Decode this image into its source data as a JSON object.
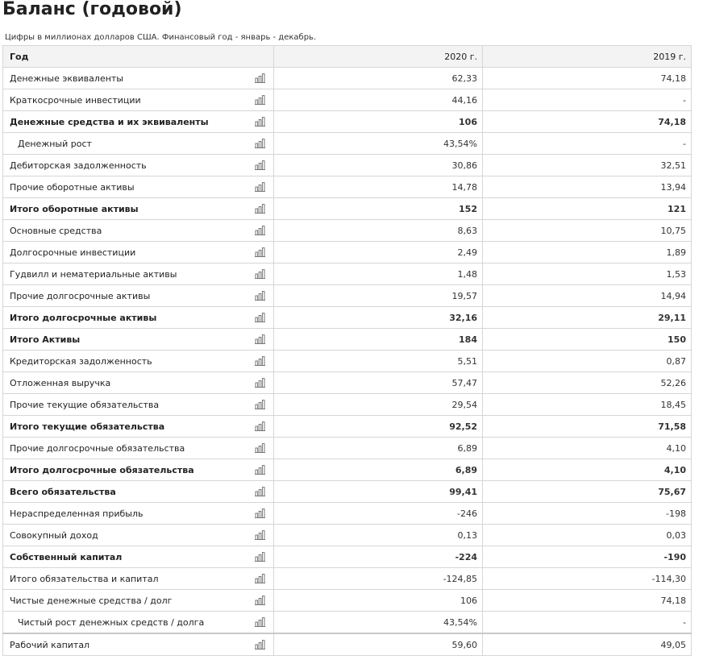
{
  "page": {
    "title": "Баланс (годовой)",
    "subtitle": "Цифры в миллионах долларов США. Финансовый год - январь - декабрь."
  },
  "table": {
    "header": {
      "label": "Год",
      "col1": "2020 г.",
      "col2": "2019 г."
    },
    "chart_icon": "bar-chart-icon",
    "rows": [
      {
        "label": "Денежные эквиваленты",
        "v1": "62,33",
        "v2": "74,18",
        "bold": false,
        "indent": false
      },
      {
        "label": "Краткосрочные инвестиции",
        "v1": "44,16",
        "v2": "-",
        "bold": false,
        "indent": false
      },
      {
        "label": "Денежные средства и их эквиваленты",
        "v1": "106",
        "v2": "74,18",
        "bold": true,
        "indent": false
      },
      {
        "label": "Денежный рост",
        "v1": "43,54%",
        "v2": "-",
        "bold": false,
        "indent": true
      },
      {
        "label": "Дебиторская задолженность",
        "v1": "30,86",
        "v2": "32,51",
        "bold": false,
        "indent": false
      },
      {
        "label": "Прочие оборотные активы",
        "v1": "14,78",
        "v2": "13,94",
        "bold": false,
        "indent": false
      },
      {
        "label": "Итого оборотные активы",
        "v1": "152",
        "v2": "121",
        "bold": true,
        "indent": false
      },
      {
        "label": "Основные средства",
        "v1": "8,63",
        "v2": "10,75",
        "bold": false,
        "indent": false
      },
      {
        "label": "Долгосрочные инвестиции",
        "v1": "2,49",
        "v2": "1,89",
        "bold": false,
        "indent": false
      },
      {
        "label": "Гудвилл и нематериальные активы",
        "v1": "1,48",
        "v2": "1,53",
        "bold": false,
        "indent": false
      },
      {
        "label": "Прочие долгосрочные активы",
        "v1": "19,57",
        "v2": "14,94",
        "bold": false,
        "indent": false
      },
      {
        "label": "Итого долгосрочные активы",
        "v1": "32,16",
        "v2": "29,11",
        "bold": true,
        "indent": false
      },
      {
        "label": "Итого Активы",
        "v1": "184",
        "v2": "150",
        "bold": true,
        "indent": false
      },
      {
        "label": "Кредиторская задолженность",
        "v1": "5,51",
        "v2": "0,87",
        "bold": false,
        "indent": false
      },
      {
        "label": "Отложенная выручка",
        "v1": "57,47",
        "v2": "52,26",
        "bold": false,
        "indent": false
      },
      {
        "label": "Прочие текущие обязательства",
        "v1": "29,54",
        "v2": "18,45",
        "bold": false,
        "indent": false
      },
      {
        "label": "Итого текущие обязательства",
        "v1": "92,52",
        "v2": "71,58",
        "bold": true,
        "indent": false
      },
      {
        "label": "Прочие долгосрочные обязательства",
        "v1": "6,89",
        "v2": "4,10",
        "bold": false,
        "indent": false
      },
      {
        "label": "Итого долгосрочные обязательства",
        "v1": "6,89",
        "v2": "4,10",
        "bold": true,
        "indent": false
      },
      {
        "label": "Всего обязательства",
        "v1": "99,41",
        "v2": "75,67",
        "bold": true,
        "indent": false
      },
      {
        "label": "Нераспределенная прибыль",
        "v1": "-246",
        "v2": "-198",
        "bold": false,
        "indent": false
      },
      {
        "label": "Совокупный доход",
        "v1": "0,13",
        "v2": "0,03",
        "bold": false,
        "indent": false
      },
      {
        "label": "Собственный капитал",
        "v1": "-224",
        "v2": "-190",
        "bold": true,
        "indent": false
      },
      {
        "label": "Итого обязательства и капитал",
        "v1": "-124,85",
        "v2": "-114,30",
        "bold": false,
        "indent": false
      },
      {
        "label": "Чистые денежные средства / долг",
        "v1": "106",
        "v2": "74,18",
        "bold": false,
        "indent": false
      },
      {
        "label": "Чистый рост денежных средств / долга",
        "v1": "43,54%",
        "v2": "-",
        "bold": false,
        "indent": true
      },
      {
        "label": "Рабочий капитал",
        "v1": "59,60",
        "v2": "49,05",
        "bold": false,
        "indent": false
      }
    ]
  }
}
